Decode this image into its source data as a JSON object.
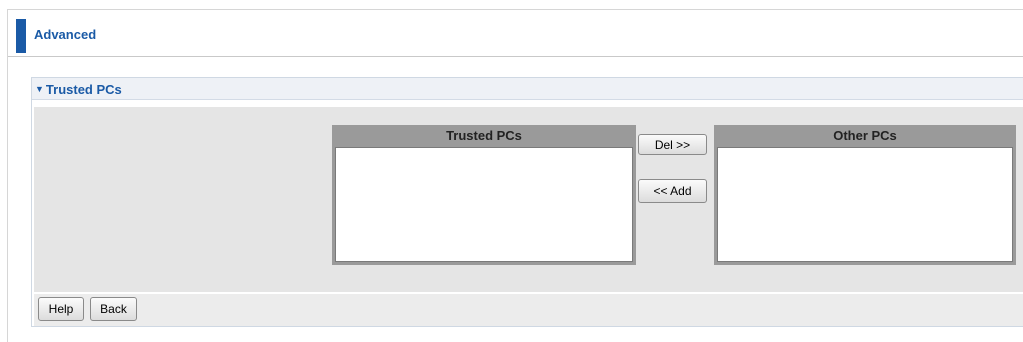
{
  "header": {
    "title": "Advanced"
  },
  "section": {
    "title": "Trusted PCs",
    "collapse_icon": "triangle-down-icon"
  },
  "trusted_list": {
    "header": "Trusted PCs",
    "items": []
  },
  "other_list": {
    "header": "Other PCs",
    "items": []
  },
  "buttons": {
    "del": "Del >>",
    "add": "<< Add",
    "help": "Help",
    "back": "Back"
  },
  "colors": {
    "accent": "#1a5aa6",
    "panel_bg": "#e5e5e5",
    "listbox_frame": "#9a9a9a"
  }
}
